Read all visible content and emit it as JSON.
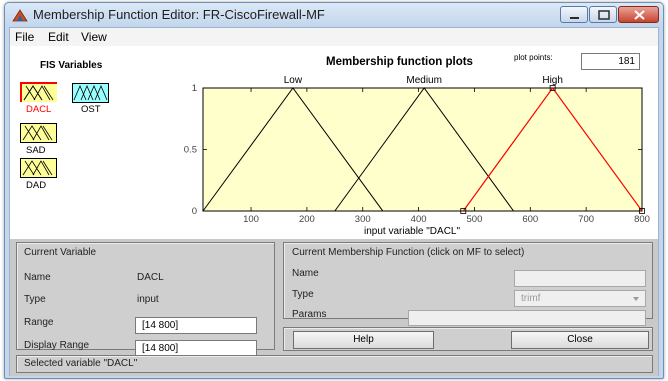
{
  "window": {
    "title": "Membership Function Editor: FR-CiscoFirewall-MF"
  },
  "menu": [
    "File",
    "Edit",
    "View"
  ],
  "fis": {
    "heading": "FIS Variables",
    "variables": [
      {
        "label": "DACL",
        "fill": "#ffff99",
        "selected": true
      },
      {
        "label": "OST",
        "fill": "#99ffff",
        "selected": false
      },
      {
        "label": "SAD",
        "fill": "#ffff99",
        "selected": false
      },
      {
        "label": "DAD",
        "fill": "#ffff99",
        "selected": false
      }
    ]
  },
  "plot": {
    "title": "Membership function plots",
    "plot_points_label": "plot points:",
    "plot_points_value": "181",
    "xlabel": "input variable \"DACL\"",
    "x_ticks": [
      "100",
      "200",
      "300",
      "400",
      "500",
      "600",
      "700",
      "800"
    ],
    "y_ticks": [
      "0",
      "0.5",
      "1"
    ],
    "background": "#ffffcc",
    "selected_color": "#ff0000"
  },
  "chart_data": {
    "type": "line",
    "title": "Membership function plots",
    "xlabel": "input variable \"DACL\"",
    "ylabel": "",
    "xlim": [
      14,
      800
    ],
    "ylim": [
      0,
      1
    ],
    "series": [
      {
        "name": "Low",
        "x": [
          14,
          175,
          336
        ],
        "y": [
          0,
          1,
          0
        ]
      },
      {
        "name": "Medium",
        "x": [
          250,
          410,
          570
        ],
        "y": [
          0,
          1,
          0
        ]
      },
      {
        "name": "High",
        "x": [
          480,
          640,
          800
        ],
        "y": [
          0,
          1,
          0
        ]
      }
    ]
  },
  "current_variable": {
    "heading": "Current Variable",
    "name_label": "Name",
    "name_value": "DACL",
    "type_label": "Type",
    "type_value": "input",
    "range_label": "Range",
    "range_value": "[14 800]",
    "display_range_label": "Display Range",
    "display_range_value": "[14 800]"
  },
  "current_mf": {
    "heading": "Current Membership Function (click on MF to select)",
    "name_label": "Name",
    "name_value": "",
    "type_label": "Type",
    "type_value": "trimf",
    "params_label": "Params",
    "params_value": ""
  },
  "buttons": {
    "help": "Help",
    "close": "Close"
  },
  "status": "Selected variable \"DACL\""
}
